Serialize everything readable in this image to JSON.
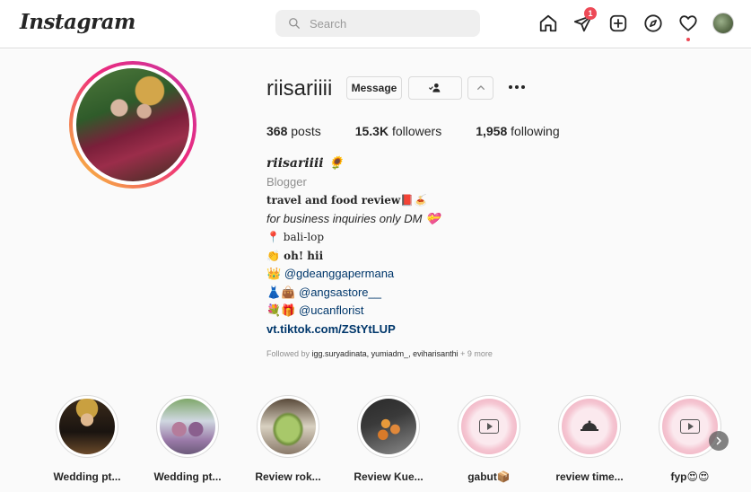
{
  "app": {
    "logo": "Instagram"
  },
  "search": {
    "placeholder": "Search"
  },
  "nav": {
    "activity_badge": "1"
  },
  "profile": {
    "username": "riisariiii",
    "message_label": "Message",
    "stats": {
      "posts_count": "368",
      "posts_label": "posts",
      "followers_count": "15.3K",
      "followers_label": "followers",
      "following_count": "1,958",
      "following_label": "following"
    },
    "bio": {
      "name": "riisariiii 🌻",
      "category": "Blogger",
      "line1": "travel and food review📕🍝",
      "line2": "for business inquiries only DM 💝",
      "line3": "📍 bali-lop",
      "line4": "👏 oh! hii",
      "line5_prefix": "👑",
      "line5_link": "@gdeanggapermana",
      "line6_prefix": "👗👜",
      "line6_link": "@angsastore__",
      "line7_prefix": "💐🎁",
      "line7_link": "@ucanflorist",
      "website": "vt.tiktok.com/ZStYtLUP"
    },
    "followed_by": {
      "prefix": "Followed by",
      "users": "igg.suryadinata, yumiadm_, eviharisanthi",
      "more": "+ 9 more"
    }
  },
  "highlights": [
    {
      "label": "Wedding pt...",
      "style": "wedding1"
    },
    {
      "label": "Wedding pt...",
      "style": "wedding2"
    },
    {
      "label": "Review rok...",
      "style": "food1"
    },
    {
      "label": "Review Kue...",
      "style": "food2"
    },
    {
      "label": "gabut📦",
      "style": "pink-play"
    },
    {
      "label": "review time...",
      "style": "pink-food"
    },
    {
      "label": "fyp😍😍",
      "style": "pink-viral"
    }
  ],
  "colors": {
    "accent_link": "#00376b",
    "badge": "#ed4956",
    "ring_start": "#f9ce34",
    "ring_end": "#c536a4"
  }
}
